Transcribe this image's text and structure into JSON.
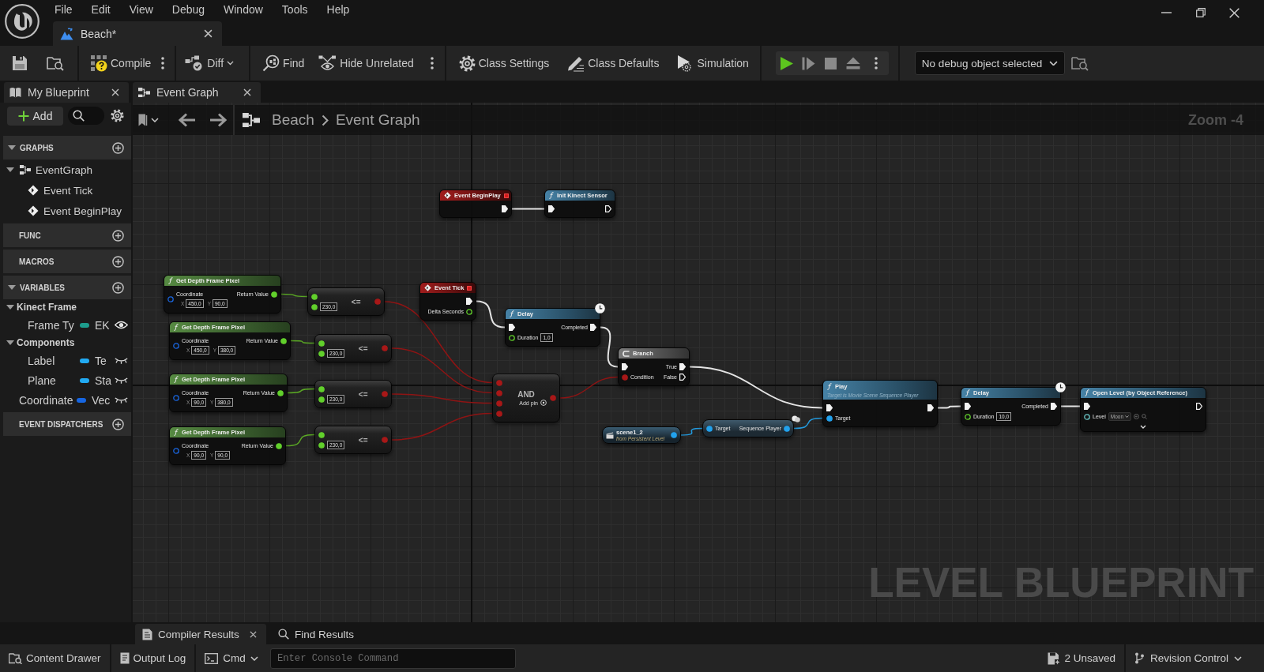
{
  "title_bar": {
    "menu": [
      "File",
      "Edit",
      "View",
      "Debug",
      "Window",
      "Tools",
      "Help"
    ],
    "document_tabs": [
      {
        "label": "Beach*",
        "selected": true
      }
    ]
  },
  "toolbar": {
    "groups": [
      {
        "buttons": [
          {
            "label": "Compile",
            "kind": "options"
          }
        ]
      },
      {
        "buttons": [
          {
            "label": "Diff",
            "kind": "dropdown"
          }
        ]
      },
      {
        "buttons": [
          {
            "label": "Find",
            "kind": "plain"
          },
          {
            "label": "Hide Unrelated",
            "kind": "options"
          }
        ]
      },
      {
        "buttons": [
          {
            "label": "Class Settings",
            "kind": "plain"
          },
          {
            "label": "Class Defaults",
            "kind": "plain"
          },
          {
            "label": "Simulation",
            "kind": "plain"
          }
        ]
      }
    ],
    "debug_object": "No debug object selected"
  },
  "my_blueprint": {
    "tab": {
      "label": "My Blueprint",
      "selected": true
    },
    "add_button": "Add",
    "sections": [
      {
        "title": "GRAPHS",
        "expanded": true,
        "items": [
          {
            "kind": "graph",
            "label": "EventGraph",
            "expanded": true,
            "children": [
              {
                "kind": "event",
                "label": "Event Tick"
              },
              {
                "kind": "event",
                "label": "Event BeginPlay"
              }
            ]
          }
        ]
      },
      {
        "title": "FUNC"
      },
      {
        "title": "MACROS"
      },
      {
        "title": "VARIABLES",
        "expanded": true,
        "items": [
          {
            "kind": "category",
            "label": "Kinect Frame",
            "expanded": true,
            "children": [
              {
                "kind": "variable",
                "label": "Frame Ty",
                "type": "EK",
                "color": "#1d9c8c",
                "instance_editable": true
              }
            ]
          },
          {
            "kind": "category",
            "label": "Components",
            "expanded": true,
            "children": [
              {
                "kind": "variable",
                "label": "Label",
                "type": "Te",
                "color": "#22aaf2",
                "instance_editable": false
              },
              {
                "kind": "variable",
                "label": "Plane",
                "type": "Sta",
                "color": "#22aaf2",
                "instance_editable": false
              }
            ]
          },
          {
            "kind": "variable",
            "label": "Coordinate",
            "type": "Vec",
            "color": "#1666e2",
            "instance_editable": false
          }
        ]
      },
      {
        "title": "EVENT DISPATCHERS"
      }
    ]
  },
  "graph_editor": {
    "tab": {
      "label": "Event Graph",
      "selected": true
    },
    "breadcrumb": [
      "Beach",
      "Event Graph"
    ],
    "zoom": "Zoom -4",
    "nodes": [
      {
        "kind": "event",
        "title": "Event BeginPlay",
        "outputs": [
          {
            "kind": "exec",
            "filled": true
          }
        ]
      },
      {
        "kind": "function",
        "title": "Init Kinect Sensor",
        "inputs": [
          {
            "kind": "exec",
            "filled": true
          }
        ],
        "outputs": [
          {
            "kind": "exec",
            "filled": false
          }
        ]
      },
      {
        "kind": "pure_function",
        "title": "Get Depth Frame Pixel",
        "inputs": [
          {
            "kind": "vector2d",
            "label": "Coordinate",
            "filled": false,
            "fields": [
              {
                "axis": "X",
                "value": "450,0"
              },
              {
                "axis": "Y",
                "value": "90,0"
              }
            ]
          }
        ],
        "outputs": [
          {
            "kind": "float",
            "label": "Return Value",
            "filled": true
          }
        ]
      },
      {
        "kind": "operator",
        "title": "<=",
        "inputs": [
          {
            "kind": "float",
            "filled": true
          },
          {
            "kind": "float",
            "filled": true,
            "value": "230,0"
          }
        ],
        "outputs": [
          {
            "kind": "bool",
            "filled": true
          }
        ]
      },
      {
        "kind": "event",
        "title": "Event Tick",
        "outputs": [
          {
            "kind": "exec",
            "filled": true
          },
          {
            "kind": "float",
            "label": "Delta Seconds",
            "filled": false
          }
        ]
      },
      {
        "kind": "latent",
        "title": "Delay",
        "inputs": [
          {
            "kind": "exec",
            "filled": true
          },
          {
            "kind": "float",
            "label": "Duration",
            "filled": false,
            "value": "1,0"
          }
        ],
        "outputs": [
          {
            "kind": "exec",
            "label": "Completed",
            "filled": true
          }
        ]
      },
      {
        "kind": "pure_function",
        "title": "Get Depth Frame Pixel",
        "inputs": [
          {
            "kind": "vector2d",
            "label": "Coordinate",
            "filled": false,
            "fields": [
              {
                "axis": "X",
                "value": "450,0"
              },
              {
                "axis": "Y",
                "value": "380,0"
              }
            ]
          }
        ],
        "outputs": [
          {
            "kind": "float",
            "label": "Return Value",
            "filled": true
          }
        ]
      },
      {
        "kind": "operator",
        "title": "<=",
        "inputs": [
          {
            "kind": "float",
            "filled": true
          },
          {
            "kind": "float",
            "filled": true,
            "value": "230,0"
          }
        ],
        "outputs": [
          {
            "kind": "bool",
            "filled": true
          }
        ]
      },
      {
        "kind": "branch",
        "title": "Branch",
        "inputs": [
          {
            "kind": "exec",
            "filled": true
          },
          {
            "kind": "bool",
            "label": "Condition",
            "filled": true
          }
        ],
        "outputs": [
          {
            "kind": "exec",
            "label": "True",
            "filled": true
          },
          {
            "kind": "exec",
            "label": "False",
            "filled": false
          }
        ]
      },
      {
        "kind": "pure_function",
        "title": "Get Depth Frame Pixel",
        "inputs": [
          {
            "kind": "vector2d",
            "label": "Coordinate",
            "filled": false,
            "fields": [
              {
                "axis": "X",
                "value": "90,0"
              },
              {
                "axis": "Y",
                "value": "380,0"
              }
            ]
          }
        ],
        "outputs": [
          {
            "kind": "float",
            "label": "Return Value",
            "filled": true
          }
        ]
      },
      {
        "kind": "operator",
        "title": "<=",
        "inputs": [
          {
            "kind": "float",
            "filled": true
          },
          {
            "kind": "float",
            "filled": true,
            "value": "230,0"
          }
        ],
        "outputs": [
          {
            "kind": "bool",
            "filled": true
          }
        ]
      },
      {
        "kind": "operator",
        "title": "AND",
        "add_pin": "Add pin",
        "inputs": [
          {
            "kind": "bool",
            "filled": true
          },
          {
            "kind": "bool",
            "filled": true
          },
          {
            "kind": "bool",
            "filled": true
          },
          {
            "kind": "bool",
            "filled": true
          }
        ],
        "outputs": [
          {
            "kind": "bool",
            "filled": true
          }
        ]
      },
      {
        "kind": "function",
        "title": "Play",
        "subtitle": "Target is Movie Scene Sequence Player",
        "inputs": [
          {
            "kind": "exec",
            "filled": true
          },
          {
            "kind": "object",
            "label": "Target",
            "filled": true
          }
        ],
        "outputs": [
          {
            "kind": "exec",
            "filled": true
          }
        ]
      },
      {
        "kind": "latent",
        "title": "Delay",
        "inputs": [
          {
            "kind": "exec",
            "filled": true
          },
          {
            "kind": "float",
            "label": "Duration",
            "filled": false,
            "value": "10,0"
          }
        ],
        "outputs": [
          {
            "kind": "exec",
            "label": "Completed",
            "filled": true
          }
        ]
      },
      {
        "kind": "function",
        "title": "Open Level (by Object Reference)",
        "advanced_collapsed": true,
        "inputs": [
          {
            "kind": "exec",
            "filled": true
          },
          {
            "kind": "soft_object",
            "label": "Level",
            "filled": false,
            "value": "Moon"
          }
        ],
        "outputs": [
          {
            "kind": "exec",
            "filled": false
          }
        ]
      },
      {
        "kind": "pure_function",
        "title": "Get Depth Frame Pixel",
        "inputs": [
          {
            "kind": "vector2d",
            "label": "Coordinate",
            "filled": false,
            "fields": [
              {
                "axis": "X",
                "value": "90,0"
              },
              {
                "axis": "Y",
                "value": "90,0"
              }
            ]
          }
        ],
        "outputs": [
          {
            "kind": "float",
            "label": "Return Value",
            "filled": true
          }
        ]
      },
      {
        "kind": "operator",
        "title": "<=",
        "inputs": [
          {
            "kind": "float",
            "filled": true
          },
          {
            "kind": "float",
            "filled": true,
            "value": "230,0"
          }
        ],
        "outputs": [
          {
            "kind": "bool",
            "filled": true
          }
        ]
      },
      {
        "kind": "actor_reference",
        "title": "scene1_2",
        "subtitle": "from Persistent Level",
        "outputs": [
          {
            "kind": "object",
            "filled": true
          }
        ]
      },
      {
        "kind": "getter",
        "inputs": [
          {
            "kind": "object",
            "label": "Target",
            "filled": true
          }
        ],
        "outputs": [
          {
            "kind": "object",
            "label": "Sequence Player",
            "filled": true
          }
        ]
      }
    ],
    "wires": [
      {
        "kind": "exec"
      },
      {
        "kind": "exec"
      },
      {
        "kind": "exec"
      },
      {
        "kind": "exec"
      },
      {
        "kind": "exec"
      },
      {
        "kind": "exec"
      },
      {
        "kind": "bool"
      },
      {
        "kind": "bool"
      },
      {
        "kind": "bool"
      },
      {
        "kind": "bool"
      },
      {
        "kind": "bool"
      },
      {
        "kind": "float"
      },
      {
        "kind": "float"
      },
      {
        "kind": "float"
      },
      {
        "kind": "float"
      },
      {
        "kind": "object"
      },
      {
        "kind": "object"
      }
    ],
    "blueprint_type": "LEVEL BLUEPRINT"
  },
  "bottom_panel": {
    "tabs": [
      {
        "label": "Compiler Results",
        "selected": true,
        "closable": true
      },
      {
        "label": "Find Results",
        "selected": false,
        "closable": false
      }
    ]
  },
  "status_bar": {
    "buttons": [
      "Content Drawer",
      "Output Log"
    ],
    "command": {
      "label": "Cmd",
      "placeholder": "Enter Console Command"
    },
    "unsaved": "2 Unsaved",
    "revision_control": "Revision Control"
  }
}
